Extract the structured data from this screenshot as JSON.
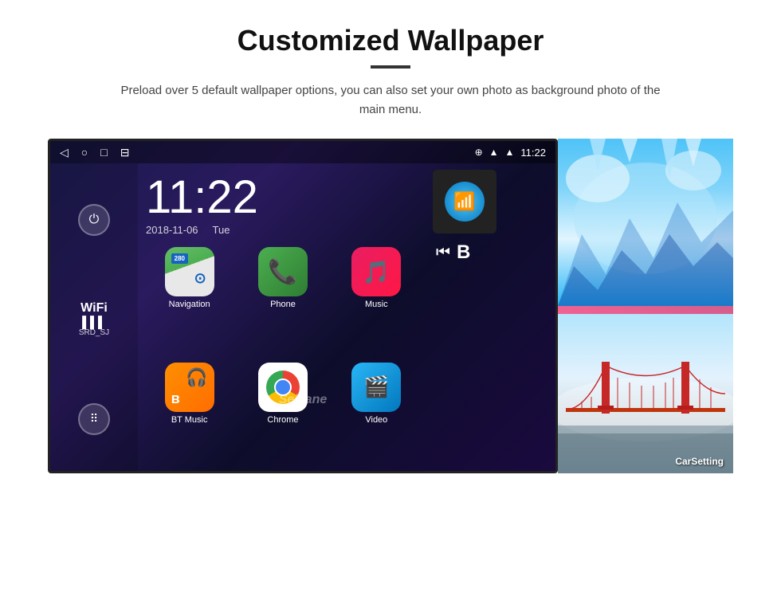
{
  "header": {
    "title": "Customized Wallpaper",
    "description": "Preload over 5 default wallpaper options, you can also set your own photo as background photo of the main menu."
  },
  "android_screen": {
    "status_bar": {
      "nav_icons": [
        "◁",
        "○",
        "□",
        "⊟"
      ],
      "right_icons": [
        "location",
        "wifi",
        "11:22"
      ]
    },
    "clock": {
      "time": "11:22",
      "date": "2018-11-06",
      "day": "Tue"
    },
    "sidebar": {
      "wifi_label": "WiFi",
      "wifi_network": "SRD_SJ"
    },
    "apps": [
      {
        "name": "Navigation",
        "icon_type": "nav"
      },
      {
        "name": "Phone",
        "icon_type": "phone"
      },
      {
        "name": "Music",
        "icon_type": "music"
      },
      {
        "name": "BT Music",
        "icon_type": "bt"
      },
      {
        "name": "Chrome",
        "icon_type": "chrome"
      },
      {
        "name": "Video",
        "icon_type": "video"
      }
    ],
    "carsetting_label": "CarSetting",
    "watermark": "Seicane"
  }
}
